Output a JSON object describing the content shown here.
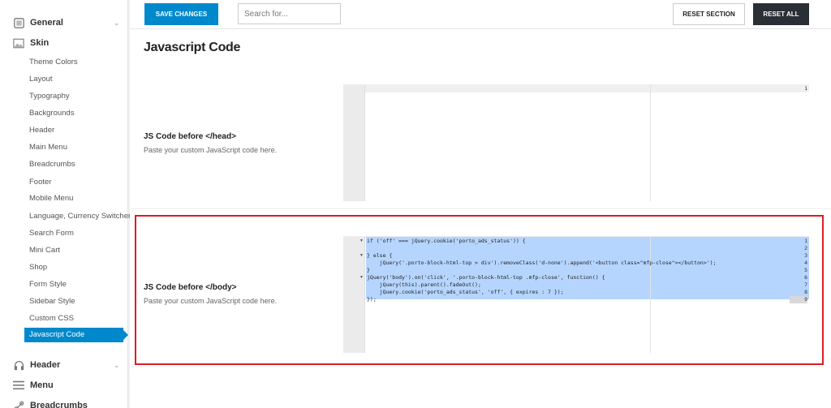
{
  "sidebar": {
    "sections": [
      {
        "label": "General",
        "icon": "gear-icon",
        "expanded": false
      },
      {
        "label": "Skin",
        "icon": "image-icon",
        "expanded": true
      },
      {
        "label": "Header",
        "icon": "headphones-icon",
        "expanded": false
      },
      {
        "label": "Menu",
        "icon": "menu-icon",
        "expanded": false
      },
      {
        "label": "Breadcrumbs",
        "icon": "link-icon",
        "expanded": false
      }
    ],
    "skin_items": [
      "Theme Colors",
      "Layout",
      "Typography",
      "Backgrounds",
      "Header",
      "Main Menu",
      "Breadcrumbs",
      "Footer",
      "Mobile Menu",
      "Language, Currency Switcher",
      "Search Form",
      "Mini Cart",
      "Shop",
      "Form Style",
      "Sidebar Style",
      "Custom CSS",
      "Javascript Code"
    ],
    "active_item": "Javascript Code"
  },
  "toolbar": {
    "save_label": "SAVE CHANGES",
    "search_placeholder": "Search for...",
    "reset_section_label": "RESET SECTION",
    "reset_all_label": "RESET ALL"
  },
  "page_title": "Javascript Code",
  "options": [
    {
      "title": "JS Code before </head>",
      "description": "Paste your custom JavaScript code here.",
      "line_numbers": [
        "1"
      ],
      "code": []
    },
    {
      "title": "JS Code before </body>",
      "description": "Paste your custom JavaScript code here.",
      "line_numbers": [
        "1",
        "2",
        "3",
        "4",
        "5",
        "6",
        "7",
        "8",
        "9"
      ],
      "code": [
        "if ('off' === jQuery.cookie('porto_ads_status')) {",
        "",
        "} else {",
        "    jQuery('.porto-block-html-top > div').removeClass('d-none').append('<button class=\"mfp-close\"></button>');",
        "}",
        "jQuery('body').on('click', '.porto-block-html-top .mfp-close', function() {",
        "    jQuery(this).parent().fadeOut();",
        "    jQuery.cookie('porto_ads_status', 'off', { expires : 7 });",
        "});"
      ],
      "highlighted": true
    }
  ],
  "colors": {
    "accent": "#0088cc",
    "reset_all_bg": "#2a2f35",
    "highlight_border": "#e11b22",
    "selection": "#b5d5ff"
  }
}
